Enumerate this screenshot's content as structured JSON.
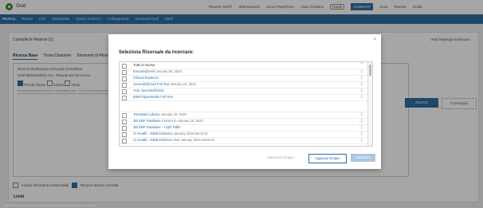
{
  "app": {
    "brand": "Ovid"
  },
  "top_links": [
    "Risorse Ovid®",
    "Abbonamenti",
    "Cerca Paperforce",
    "Aiuto Ovidiano",
    "Guide",
    "OvidMAPP",
    "Aiuto",
    "Risorse",
    "Guida"
  ],
  "nav": [
    "Ricerca",
    "Riviste",
    "Libri",
    "Multimedia",
    "Spazio di lavoro",
    "Collegamenti",
    "Strumenti Ovid",
    "Medi"
  ],
  "db_select": "Consulta le Risorse (1)",
  "db_right": "Vedi Riepilogo Selezione",
  "tabs": [
    "Ricerca Base",
    "Trova Citazione",
    "Strumenti di Ricerca"
  ],
  "search": {
    "line1": "Ricerca Multicampo Incrociati Semantica",
    "line2": "Ovid MEDLINE(R) ALL, Risorse per la ricerca",
    "mode_options": [
      "Parole chiave",
      "Autore",
      "Titolo"
    ],
    "placeholder": "Immettere parole chiave o una frase (usa * o $ come troncamento)",
    "search_button": "Ricerca",
    "history_button": "Cronologia"
  },
  "limits_options": [
    "Includi riferimenti multimediali",
    "Ricerca termini correlati"
  ],
  "limits_label": "Limiti",
  "modal": {
    "close": "×",
    "title": "Seleziona Risorsa/e da ricercare:",
    "rows": [
      {
        "label": "Tutte le risorse",
        "sub": "",
        "plain": true,
        "caret": "^"
      },
      {
        "label": "Emcare@Ovid",
        "sub": " January 06, 2024",
        "plain": false,
        "info": "ⓘ"
      },
      {
        "label": "Clinical Evidence",
        "sub": "",
        "plain": false,
        "info": "ⓘ"
      },
      {
        "label": "Journals@Ovid Full Text",
        "sub": " January 15, 2024",
        "plain": false,
        "info": "ⓘ"
      },
      {
        "label": "Your Journals@Ovid",
        "sub": "",
        "plain": false,
        "info": "ⓘ"
      },
      {
        "label": "EBM PaperWorks Full Text",
        "sub": "",
        "plain": false,
        "info": "ⓘ"
      },
      {
        "label": "",
        "sub": "",
        "plain": true,
        "info": ""
      },
      {
        "label": "Transplant Library",
        "sub": " January 15, 2024",
        "plain": false,
        "info": "ⓘ"
      },
      {
        "label": "JBI EBP Database",
        "sub": " Current to January 15, 2024",
        "plain": false,
        "info": "ⓘ"
      },
      {
        "label": "JBI EBP Database – Light Table",
        "sub": "",
        "plain": false,
        "info": "ⓘ"
      },
      {
        "label": "CI Health – EBM Evidence",
        "sub": " January 2024 Week 01",
        "plain": false,
        "info": "ⓘ"
      },
      {
        "label": "CI Health – EBM Evidence Text",
        "sub": " January 2024 Week 01",
        "plain": false,
        "info": "ⓘ"
      }
    ],
    "btn_select_group": "Seleziona Gruppo",
    "btn_add_group": "Aggiungi Gruppo",
    "btn_confirm": "Seleziona"
  },
  "footer": "Informazioni su Ovid Privacy Termini di utilizzo Assistenza clienti"
}
